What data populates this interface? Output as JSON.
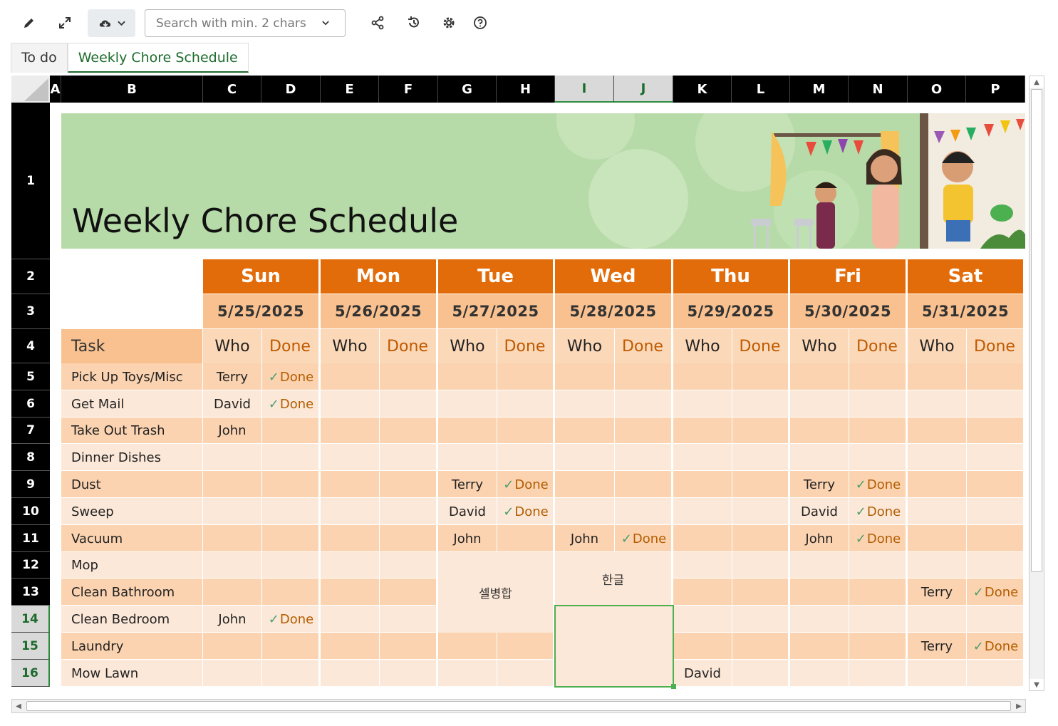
{
  "toolbar": {
    "search_placeholder": "Search with min. 2 chars"
  },
  "tabs": [
    {
      "label": "To do",
      "active": false
    },
    {
      "label": "Weekly Chore Schedule",
      "active": true
    }
  ],
  "columns": [
    "A",
    "B",
    "C",
    "D",
    "E",
    "F",
    "G",
    "H",
    "I",
    "J",
    "K",
    "L",
    "M",
    "N",
    "O",
    "P"
  ],
  "selected_columns": [
    "I",
    "J"
  ],
  "rows": [
    "1",
    "2",
    "3",
    "4",
    "5",
    "6",
    "7",
    "8",
    "9",
    "10",
    "11",
    "12",
    "13",
    "14",
    "15",
    "16"
  ],
  "selected_rows": [
    "14",
    "15",
    "16"
  ],
  "banner": {
    "title": "Weekly Chore Schedule",
    "colors": {
      "bg": "#b7dba8"
    }
  },
  "days": [
    {
      "name": "Sun",
      "date": "5/25/2025"
    },
    {
      "name": "Mon",
      "date": "5/26/2025"
    },
    {
      "name": "Tue",
      "date": "5/27/2025"
    },
    {
      "name": "Wed",
      "date": "5/28/2025"
    },
    {
      "name": "Thu",
      "date": "5/29/2025"
    },
    {
      "name": "Fri",
      "date": "5/30/2025"
    },
    {
      "name": "Sat",
      "date": "5/31/2025"
    }
  ],
  "headers": {
    "task": "Task",
    "who": "Who",
    "done": "Done"
  },
  "done_mark": "✓",
  "done_label": "Done",
  "tasks": [
    {
      "task": "Pick Up Toys/Misc",
      "cells": [
        [
          "Terry",
          true
        ],
        [
          "",
          false
        ],
        [
          "",
          false
        ],
        [
          "",
          false
        ],
        [
          "",
          false
        ],
        [
          "",
          false
        ],
        [
          "",
          false
        ]
      ]
    },
    {
      "task": "Get Mail",
      "cells": [
        [
          "David",
          true
        ],
        [
          "",
          false
        ],
        [
          "",
          false
        ],
        [
          "",
          false
        ],
        [
          "",
          false
        ],
        [
          "",
          false
        ],
        [
          "",
          false
        ]
      ]
    },
    {
      "task": "Take Out Trash",
      "cells": [
        [
          "John",
          false
        ],
        [
          "",
          false
        ],
        [
          "",
          false
        ],
        [
          "",
          false
        ],
        [
          "",
          false
        ],
        [
          "",
          false
        ],
        [
          "",
          false
        ]
      ]
    },
    {
      "task": "Dinner Dishes",
      "cells": [
        [
          "",
          false
        ],
        [
          "",
          false
        ],
        [
          "",
          false
        ],
        [
          "",
          false
        ],
        [
          "",
          false
        ],
        [
          "",
          false
        ],
        [
          "",
          false
        ]
      ]
    },
    {
      "task": "Dust",
      "cells": [
        [
          "",
          false
        ],
        [
          "",
          false
        ],
        [
          "Terry",
          true
        ],
        [
          "",
          false
        ],
        [
          "",
          false
        ],
        [
          "Terry",
          true
        ],
        [
          "",
          false
        ]
      ]
    },
    {
      "task": "Sweep",
      "cells": [
        [
          "",
          false
        ],
        [
          "",
          false
        ],
        [
          "David",
          true
        ],
        [
          "",
          false
        ],
        [
          "",
          false
        ],
        [
          "David",
          true
        ],
        [
          "",
          false
        ]
      ]
    },
    {
      "task": "Vacuum",
      "cells": [
        [
          "",
          false
        ],
        [
          "",
          false
        ],
        [
          "John",
          false
        ],
        [
          "John",
          true
        ],
        [
          "",
          false
        ],
        [
          "John",
          true
        ],
        [
          "",
          false
        ]
      ]
    },
    {
      "task": "Mop",
      "cells": [
        [
          "",
          false
        ],
        [
          "",
          false
        ],
        [
          "",
          false
        ],
        [
          "",
          false
        ],
        [
          "",
          false
        ],
        [
          "",
          false
        ],
        [
          "",
          false
        ]
      ]
    },
    {
      "task": "Clean Bathroom",
      "cells": [
        [
          "",
          false
        ],
        [
          "",
          false
        ],
        [
          "",
          false
        ],
        [
          "",
          false
        ],
        [
          "",
          false
        ],
        [
          "",
          false
        ],
        [
          "Terry",
          true
        ]
      ]
    },
    {
      "task": "Clean Bedroom",
      "cells": [
        [
          "John",
          true
        ],
        [
          "",
          false
        ],
        [
          "",
          false
        ],
        [
          "",
          false
        ],
        [
          "",
          false
        ],
        [
          "",
          false
        ],
        [
          "",
          false
        ]
      ]
    },
    {
      "task": "Laundry",
      "cells": [
        [
          "",
          false
        ],
        [
          "",
          false
        ],
        [
          "",
          false
        ],
        [
          "",
          false
        ],
        [
          "",
          false
        ],
        [
          "",
          false
        ],
        [
          "Terry",
          true
        ]
      ]
    },
    {
      "task": "Mow Lawn",
      "cells": [
        [
          "",
          false
        ],
        [
          "",
          false
        ],
        [
          "",
          false
        ],
        [
          "",
          false
        ],
        [
          "David",
          false
        ],
        [
          "",
          false
        ],
        [
          "",
          false
        ]
      ]
    }
  ],
  "merged_cells": [
    {
      "text": "셀병합"
    },
    {
      "text": "한글"
    }
  ],
  "colors": {
    "orange": "#e36c0a",
    "peach": "#f9c18f",
    "row_dark": "#fbd3b0",
    "row_light": "#fce8d8",
    "selection": "#4caf50",
    "check": "#4a9e6b"
  }
}
